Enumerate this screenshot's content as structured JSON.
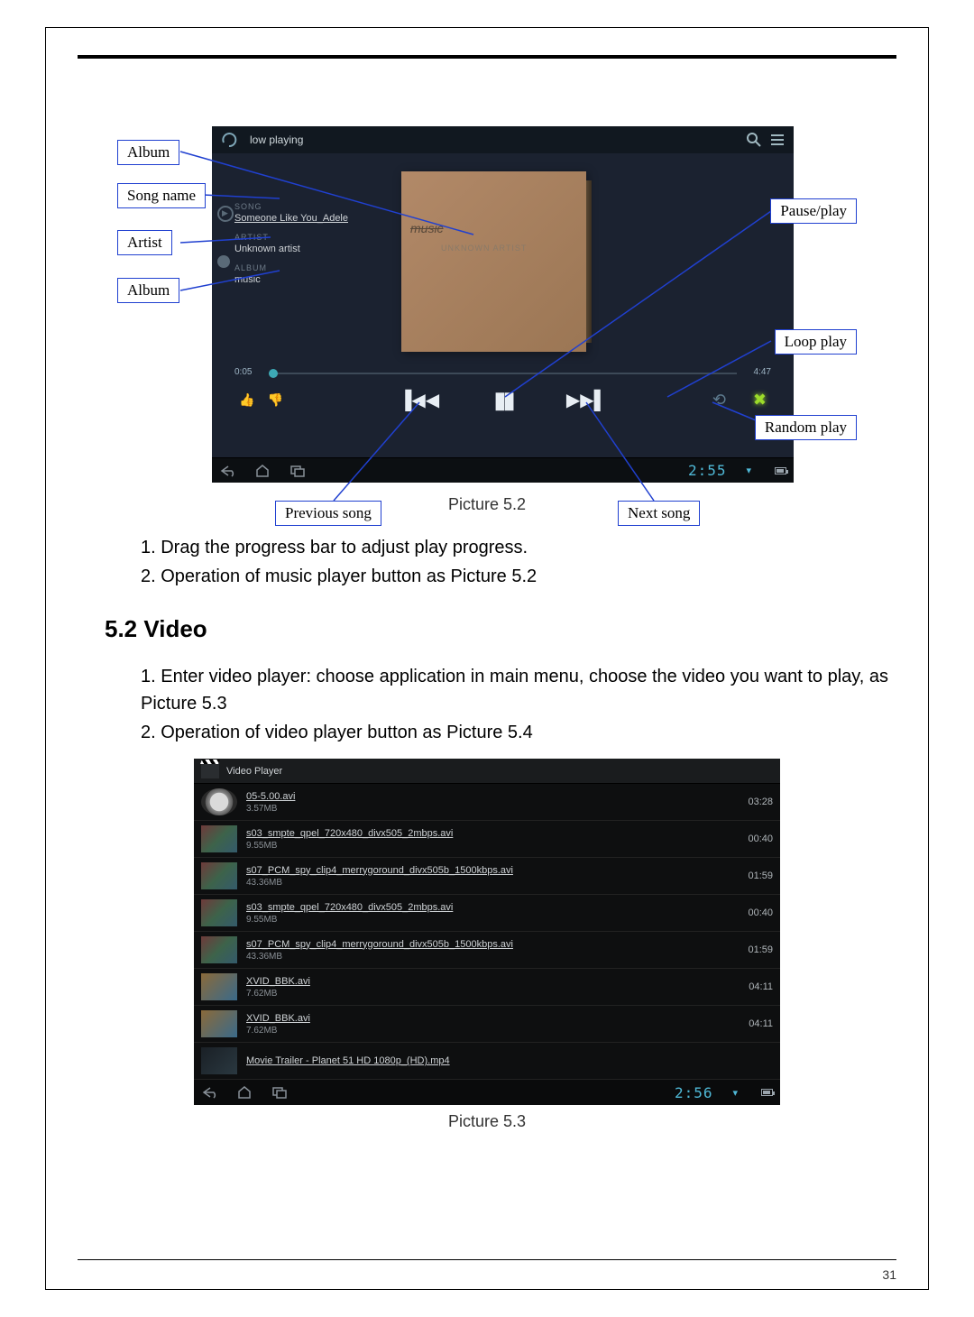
{
  "page_number": "31",
  "caption_52": "Picture 5.2",
  "caption_53": "Picture 5.3",
  "section_heading": "5.2 Video",
  "instructions_a": {
    "1": "1. Drag the progress bar to adjust play progress.",
    "2": "2. Operation of music player button as Picture 5.2"
  },
  "instructions_b": {
    "1": "1. Enter video player: choose application in main menu, choose the video you want to play, as Picture 5.3",
    "2": "2. Operation of video player button as Picture 5.4"
  },
  "callouts": {
    "album_top": "Album",
    "song_name": "Song name",
    "artist": "Artist",
    "album_bottom": "Album",
    "pause_play": "Pause/play",
    "loop_play": "Loop play",
    "random_play": "Random play",
    "previous_song": "Previous song",
    "next_song": "Next song"
  },
  "music_player": {
    "header_title": "low playing",
    "song_label": "SONG",
    "song_value": "Someone Like You_Adele",
    "artist_label": "ARTIST",
    "artist_value": "Unknown artist",
    "album_label": "ALBUM",
    "album_value": "music",
    "album_art_title": "music",
    "album_art_sub": "UNKNOWN ARTIST",
    "time_elapsed": "0:05",
    "time_total": "4:47",
    "clock": "2:55"
  },
  "video_player": {
    "header_title": "Video Player",
    "clock": "2:56",
    "items": [
      {
        "name": "05-5.00.avi",
        "size": "3.57MB",
        "dur": "03:28",
        "thumb": "reel"
      },
      {
        "name": "s03_smpte_qpel_720x480_divx505_2mbps.avi",
        "size": "9.55MB",
        "dur": "00:40",
        "thumb": "clip"
      },
      {
        "name": "s07_PCM_spy_clip4_merrygoround_divx505b_1500kbps.avi",
        "size": "43.36MB",
        "dur": "01:59",
        "thumb": "clip"
      },
      {
        "name": "s03_smpte_qpel_720x480_divx505_2mbps.avi",
        "size": "9.55MB",
        "dur": "00:40",
        "thumb": "clip"
      },
      {
        "name": "s07_PCM_spy_clip4_merrygoround_divx505b_1500kbps.avi",
        "size": "43.36MB",
        "dur": "01:59",
        "thumb": "clip"
      },
      {
        "name": "XVID_BBK.avi",
        "size": "7.62MB",
        "dur": "04:11",
        "thumb": "game"
      },
      {
        "name": "XVID_BBK.avi",
        "size": "7.62MB",
        "dur": "04:11",
        "thumb": "game"
      },
      {
        "name": "Movie Trailer - Planet 51 HD 1080p_(HD).mp4",
        "size": "",
        "dur": "",
        "thumb": "dark"
      }
    ]
  }
}
